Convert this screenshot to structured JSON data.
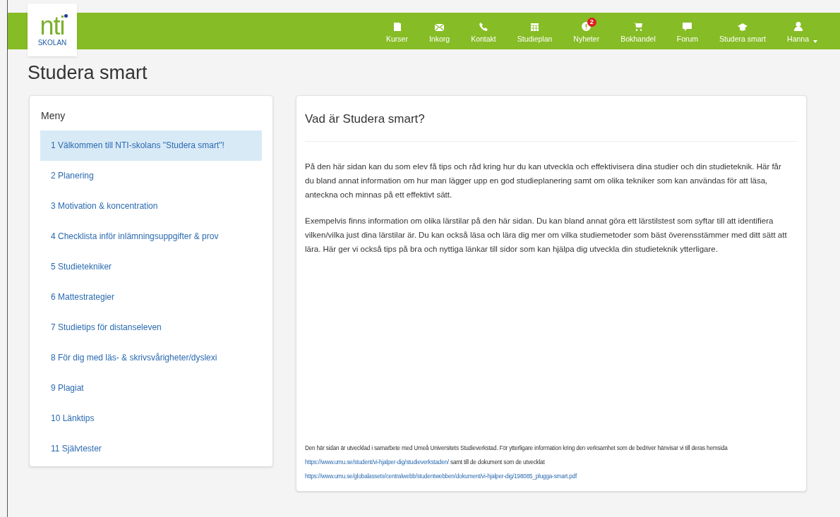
{
  "logo": {
    "text": "nti",
    "subtext": "SKOLAN"
  },
  "nav": [
    {
      "label": "Kurser"
    },
    {
      "label": "Inkorg"
    },
    {
      "label": "Kontakt"
    },
    {
      "label": "Studieplan"
    },
    {
      "label": "Nyheter",
      "badge": "2"
    },
    {
      "label": "Bokhandel"
    },
    {
      "label": "Forum"
    },
    {
      "label": "Studera smart"
    },
    {
      "label": "Hanna",
      "dropdown": true
    }
  ],
  "page_title": "Studera smart",
  "menu": {
    "title": "Meny",
    "items": [
      {
        "label": "1 Välkommen till NTI-skolans \"Studera smart\"!",
        "selected": true
      },
      {
        "label": "2 Planering",
        "selected": false
      },
      {
        "label": "3 Motivation & koncentration",
        "selected": false
      },
      {
        "label": "4 Checklista inför inlämningsuppgifter & prov",
        "selected": false
      },
      {
        "label": "5 Studietekniker",
        "selected": false
      },
      {
        "label": "6 Mattestrategier",
        "selected": false
      },
      {
        "label": "7 Studietips för distanseleven",
        "selected": false
      },
      {
        "label": "8 För dig med läs- & skrivsvårigheter/dyslexi",
        "selected": false
      },
      {
        "label": "9 Plagiat",
        "selected": false
      },
      {
        "label": "10 Länktips",
        "selected": false
      },
      {
        "label": "11 Självtester",
        "selected": false
      }
    ]
  },
  "content": {
    "title": "Vad är Studera smart?",
    "paragraphs": [
      "På den här sidan kan du som elev få tips och råd kring hur du kan utveckla och effektivisera dina studier och din studieteknik. Här får du bland annat information om hur man lägger upp en god studieplanering samt om olika tekniker som kan användas för att läsa, anteckna och minnas på ett effektivt sätt.",
      "Exempelvis finns information om olika lärstilar på den här sidan. Du kan bland annat göra ett lärstilstest som syftar till att identifiera vilken/vilka just dina lärstilar är. Du kan också läsa och lära dig mer om vilka studiemetoder som bäst överensstämmer med ditt sätt att lära. Här ger vi också tips på bra och nyttiga länkar till sidor som kan hjälpa dig utveckla din studieteknik ytterligare."
    ],
    "footer": [
      {
        "kind": "text",
        "text": "Den här sidan är utvecklad i samarbete med Umeå Universitets Studieverkstad. För ytterligare information kring den verksamhet som de bedriver hänvisar vi till deras hemsida "
      },
      {
        "kind": "link",
        "text": "https://www.umu.se/student/vi-hjalper-dig/studieverkstaden/"
      },
      {
        "kind": "text",
        "text": " samt till de dokument som de utvecklat "
      },
      {
        "kind": "link",
        "text": "https://www.umu.se/globalassets/centralwebb/studentwebben/dokument/vi-hjalper-dig/198085_plugga-smart.pdf"
      }
    ]
  }
}
